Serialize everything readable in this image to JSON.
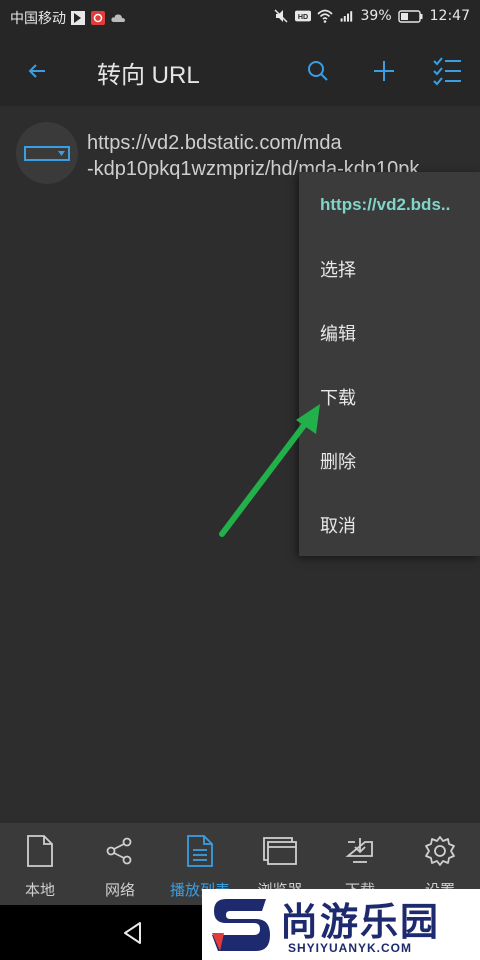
{
  "status_bar": {
    "carrier": "中国移动",
    "battery": "39%",
    "time": "12:47",
    "icons": [
      "flipboard-icon",
      "app-badge-icon",
      "cloud-icon",
      "mute-icon",
      "hd-icon",
      "wifi-icon",
      "signal-icon",
      "battery-icon"
    ]
  },
  "app_bar": {
    "title": "转向 URL",
    "back_icon": "back-arrow-icon",
    "actions": [
      "search-icon",
      "plus-icon",
      "checklist-icon"
    ]
  },
  "list": {
    "items": [
      {
        "line1": "https://vd2.bdstatic.com/mda",
        "line2": "-kdp10pkq1wzmpriz/hd/mda-kdp10pk..."
      }
    ]
  },
  "menu": {
    "header": "https://vd2.bds..",
    "items": [
      {
        "label": "选择"
      },
      {
        "label": "编辑"
      },
      {
        "label": "下载"
      },
      {
        "label": "删除"
      },
      {
        "label": "取消"
      }
    ]
  },
  "bottom_nav": {
    "items": [
      {
        "label": "本地",
        "icon": "file-icon",
        "active": false
      },
      {
        "label": "网络",
        "icon": "share-icon",
        "active": false
      },
      {
        "label": "播放列表",
        "icon": "playlist-file-icon",
        "active": true
      },
      {
        "label": "浏览器",
        "icon": "browser-window-icon",
        "active": false
      },
      {
        "label": "下载",
        "icon": "download-icon",
        "active": false
      },
      {
        "label": "设置",
        "icon": "gear-icon",
        "active": false
      }
    ]
  },
  "watermark": {
    "name": "尚游乐园",
    "domain": "SHYIYUANYK.COM"
  },
  "colors": {
    "accent": "#3a9ee3",
    "menu_header": "#7fd6c8",
    "arrow": "#22b04a",
    "background": "#2d2d2d"
  }
}
